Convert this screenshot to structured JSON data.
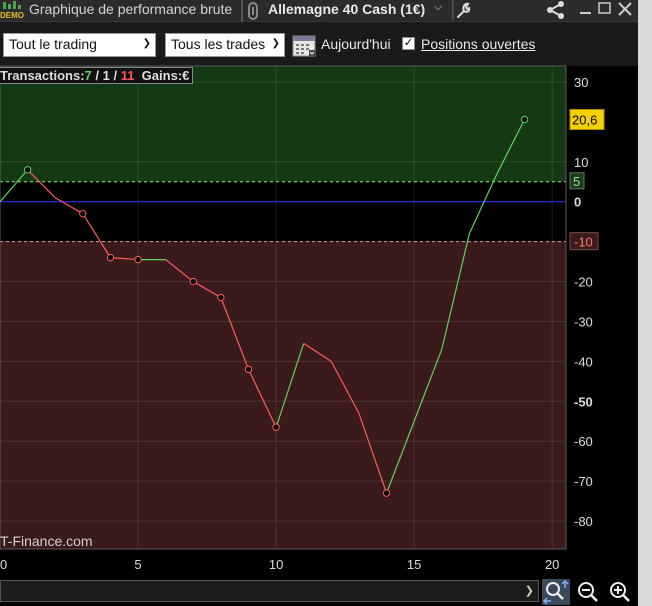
{
  "titlebar": {
    "demo_badge": "DEMO",
    "title": "Graphique de performance brute",
    "instrument": "Allemagne 40 Cash (1€)",
    "icons": [
      "demo-icon",
      "wrench-icon",
      "share-icon",
      "minimize-icon",
      "maximize-icon",
      "close-icon"
    ]
  },
  "toolbar": {
    "scope_select": "Tout le trading",
    "trades_select": "Tous les trades",
    "today_label": "Aujourd'hui",
    "open_positions_checked": true,
    "open_positions_label": "Positions ouvertes"
  },
  "stats": {
    "label": "Transactions:",
    "winners": "7",
    "sep1": " / ",
    "neutral": "1",
    "sep2": " / ",
    "losers": "11",
    "gains_label": "Gains:",
    "gains_value": "€"
  },
  "watermark": "T-Finance.com",
  "colors": {
    "gain_zone": "#153915",
    "loss_zone": "#3a1a1a",
    "up_line": "#5fd35f",
    "down_line": "#ff5a5a",
    "zero_line": "#3030ff",
    "last_value_bg": "#f5d000"
  },
  "chart_data": {
    "type": "line",
    "x": [
      0,
      1,
      2,
      3,
      4,
      5,
      6,
      7,
      8,
      9,
      10,
      11,
      12,
      13,
      14,
      15,
      16,
      17,
      18,
      19
    ],
    "y": [
      0,
      8,
      1,
      -3,
      -14,
      -14.5,
      -14.5,
      -20,
      -24,
      -42,
      -56.5,
      -35.5,
      -40,
      -53,
      -73,
      -55,
      -37,
      -8,
      7,
      20.6
    ],
    "markers_x": [
      1,
      3,
      4,
      5,
      7,
      8,
      9,
      10,
      14,
      19
    ],
    "xlim": [
      0,
      20.5
    ],
    "ylim": [
      -87,
      34
    ],
    "xticks": [
      "0",
      "5",
      "10",
      "15",
      "20"
    ],
    "xtick_values": [
      0,
      5,
      10,
      15,
      20
    ],
    "yticks": [
      "30",
      "10",
      "0",
      "-10",
      "-20",
      "-30",
      "-40",
      "-50",
      "-60",
      "-70",
      "-80"
    ],
    "ytick_values": [
      30,
      10,
      0,
      -10,
      -20,
      -30,
      -40,
      -50,
      -60,
      -70,
      -80
    ],
    "bold_yticks": [
      "0",
      "-50"
    ],
    "gain_threshold": 5,
    "gain_threshold_label": "5",
    "loss_threshold": -10,
    "loss_threshold_label": "-10",
    "last_value": 20.6,
    "last_value_label": "20,6"
  }
}
